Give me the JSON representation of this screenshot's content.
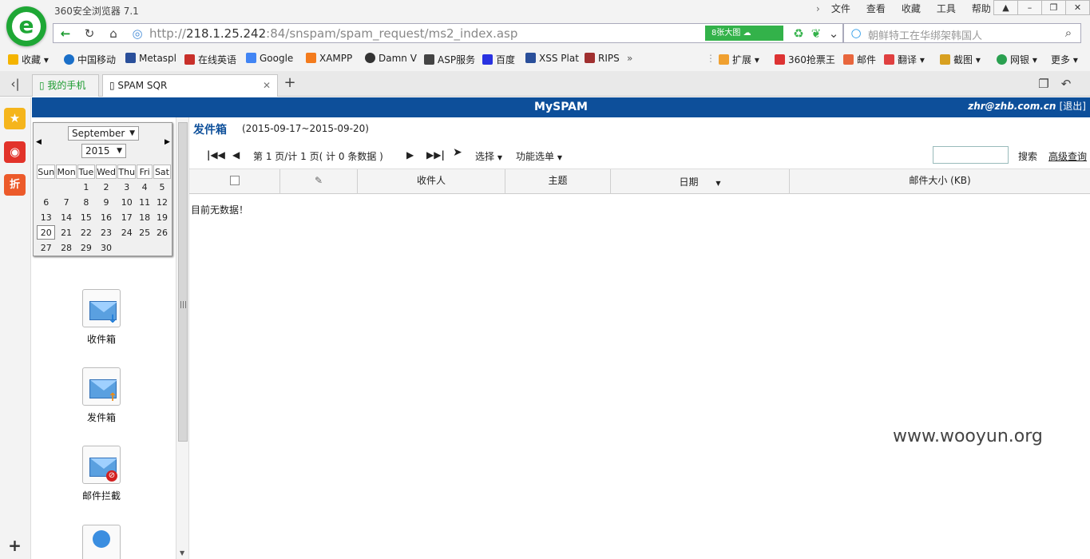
{
  "browser": {
    "app_title": "360安全浏览器 7.1",
    "menu": [
      "文件",
      "查看",
      "收藏",
      "工具",
      "帮助"
    ],
    "url_prefix": "http://",
    "url_host": "218.1.25.242",
    "url_path": ":84/snspam/spam_request/ms2_index.asp",
    "pic_button": "8张大图",
    "search_text": "朝鲜特工在华绑架韩国人",
    "bookmarks": [
      "收藏",
      "中国移动",
      "Metaspl",
      "在线英语",
      "Google",
      "XAMPP",
      "Damn V",
      "ASP服务",
      "百度",
      "XSS Plat",
      "RIPS"
    ],
    "toolbar_right": [
      "扩展",
      "360抢票王",
      "邮件",
      "翻译",
      "截图",
      "网银",
      "更多"
    ],
    "tabs": [
      {
        "label": "我的手机"
      },
      {
        "label": "SPAM SQR"
      }
    ]
  },
  "page": {
    "title": "MySPAM",
    "user_email": "zhr@zhb.com.cn",
    "logout": "[退出]"
  },
  "calendar": {
    "month": "September",
    "year": "2015",
    "weekdays": [
      "Sun",
      "Mon",
      "Tue",
      "Wed",
      "Thu",
      "Fri",
      "Sat"
    ],
    "weeks": [
      [
        "",
        "",
        "1",
        "2",
        "3",
        "4",
        "5"
      ],
      [
        "6",
        "7",
        "8",
        "9",
        "10",
        "11",
        "12"
      ],
      [
        "13",
        "14",
        "15",
        "16",
        "17",
        "18",
        "19"
      ],
      [
        "20",
        "21",
        "22",
        "23",
        "24",
        "25",
        "26"
      ],
      [
        "27",
        "28",
        "29",
        "30",
        "",
        "",
        ""
      ]
    ],
    "today": "20"
  },
  "folders": [
    {
      "label": "收件箱",
      "icon": "inbox-icon"
    },
    {
      "label": "发件箱",
      "icon": "outbox-icon"
    },
    {
      "label": "邮件拦截",
      "icon": "blocked-mail-icon"
    }
  ],
  "main": {
    "box_title": "发件箱",
    "date_range": "(2015-09-17~2015-09-20)",
    "pager_text": "第 1 页/计 1 页( 计 0 条数据 )",
    "select_menu": "选择",
    "function_menu": "功能选单",
    "search_button": "搜索",
    "advanced_search": "高级查询",
    "columns": [
      "收件人",
      "主题",
      "日期",
      "邮件大小 (KB)"
    ],
    "empty_message": "目前无数据！"
  },
  "watermark": "www.wooyun.org",
  "colors": {
    "header_blue": "#0d4f9a",
    "brand_green": "#1ea735"
  }
}
